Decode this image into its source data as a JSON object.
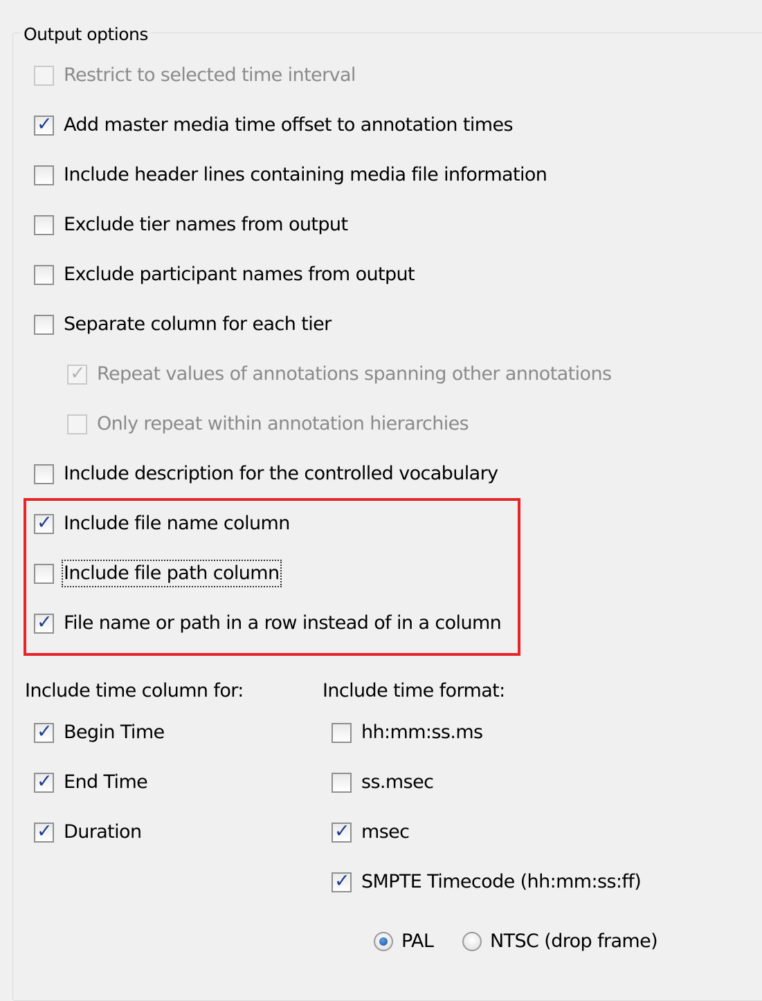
{
  "group_title": "Output options",
  "options": [
    {
      "label": "Restrict to selected time interval",
      "checked": false,
      "enabled": false
    },
    {
      "label": "Add master media time offset to annotation times",
      "checked": true,
      "enabled": true
    },
    {
      "label": "Include header lines containing media file information",
      "checked": false,
      "enabled": true
    },
    {
      "label": "Exclude tier names from output",
      "checked": false,
      "enabled": true
    },
    {
      "label": "Exclude participant names from output",
      "checked": false,
      "enabled": true
    },
    {
      "label": "Separate column for each tier",
      "checked": false,
      "enabled": true
    },
    {
      "label": "Repeat values of annotations spanning other annotations",
      "checked": true,
      "enabled": false
    },
    {
      "label": "Only repeat within annotation hierarchies",
      "checked": false,
      "enabled": false
    },
    {
      "label": "Include description for the controlled vocabulary",
      "checked": false,
      "enabled": true
    },
    {
      "label": "Include file name column",
      "checked": true,
      "enabled": true
    },
    {
      "label": "Include file path column",
      "checked": false,
      "enabled": true,
      "focused": true
    },
    {
      "label": "File name or path in a row instead of in a column",
      "checked": true,
      "enabled": true
    }
  ],
  "time_columns": {
    "heading": "Include time column for:",
    "items": [
      {
        "label": "Begin Time",
        "checked": true
      },
      {
        "label": "End Time",
        "checked": true
      },
      {
        "label": "Duration",
        "checked": true
      }
    ]
  },
  "time_formats": {
    "heading": "Include time format:",
    "items": [
      {
        "label": "hh:mm:ss.ms",
        "checked": false
      },
      {
        "label": "ss.msec",
        "checked": false
      },
      {
        "label": "msec",
        "checked": true
      },
      {
        "label": "SMPTE Timecode (hh:mm:ss:ff)",
        "checked": true
      }
    ]
  },
  "smpte_standard": {
    "options": [
      {
        "label": "PAL",
        "selected": true
      },
      {
        "label": "NTSC (drop frame)",
        "selected": false
      }
    ]
  },
  "colors": {
    "highlight": "#e82428",
    "check": "#1c3b8c",
    "background": "#f0f0f0"
  },
  "icons": {
    "check": "checkmark-icon",
    "radio": "radio-dot-icon"
  }
}
